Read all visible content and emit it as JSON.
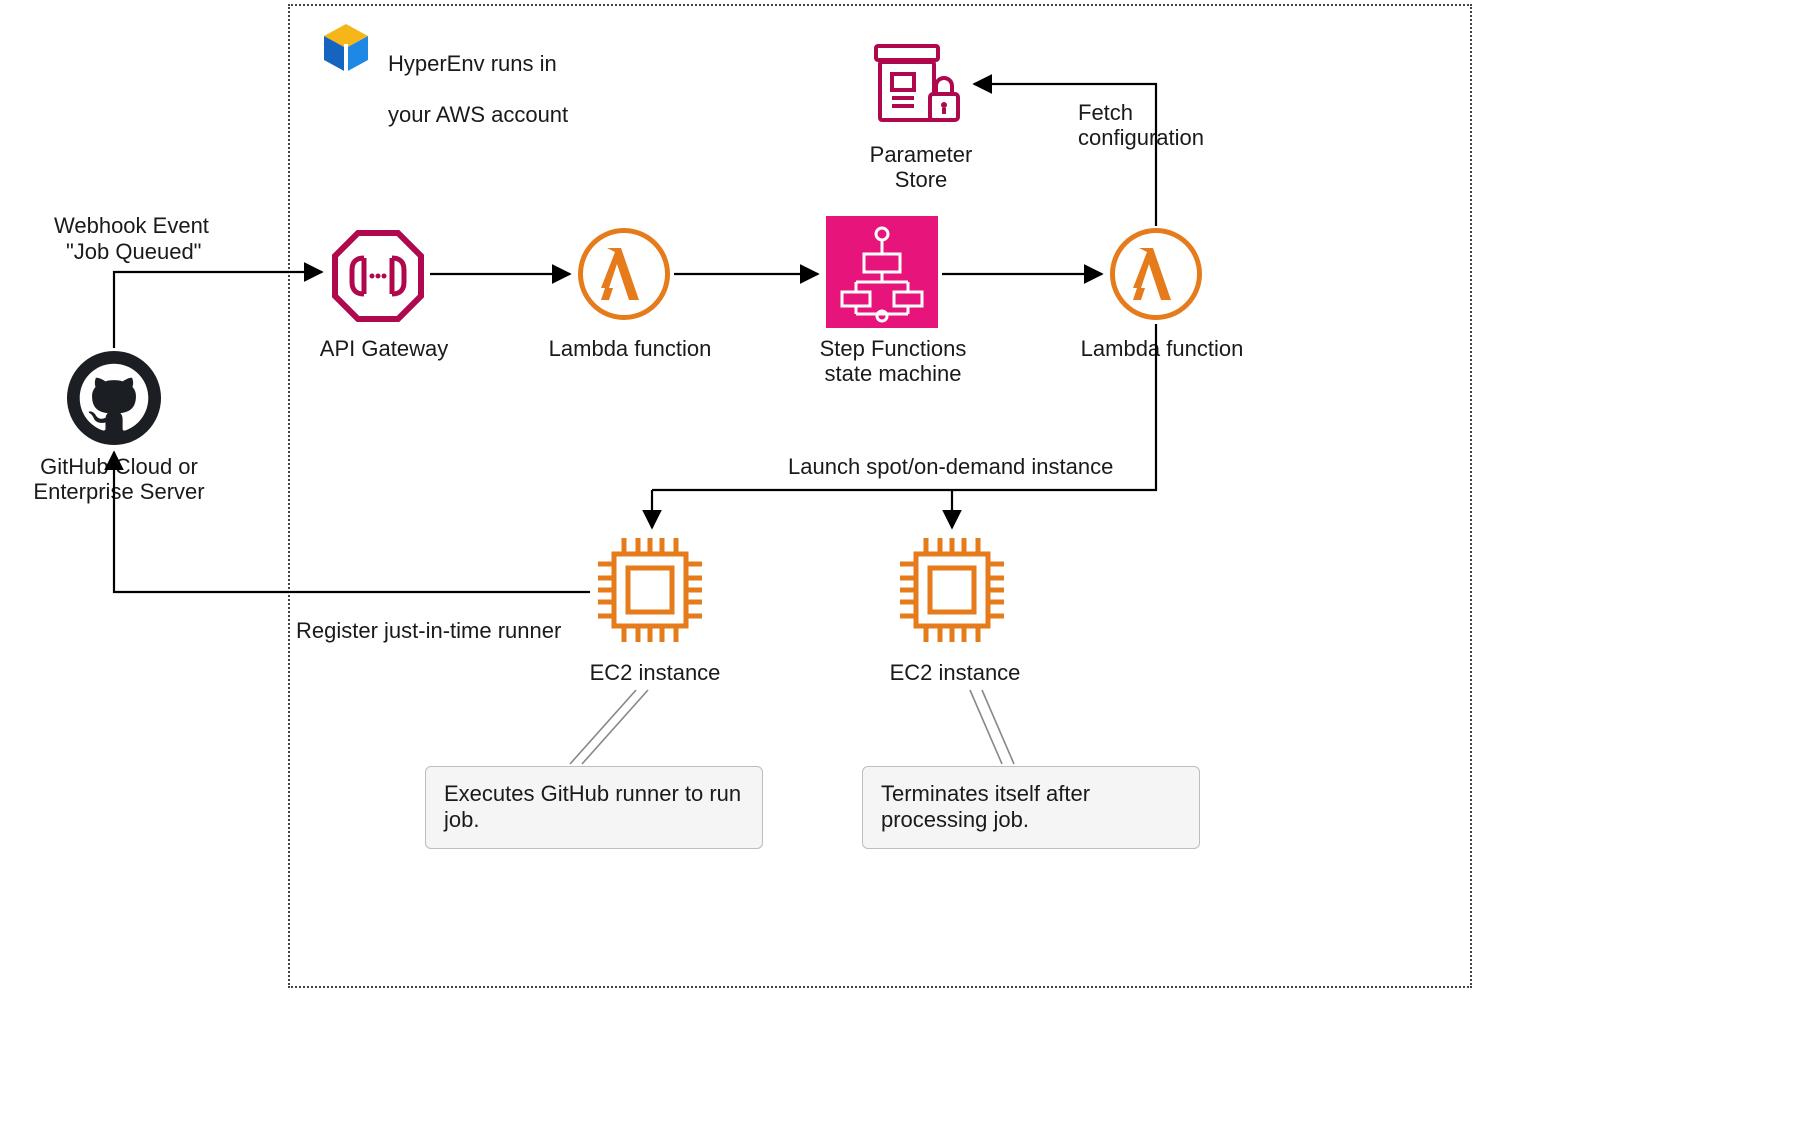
{
  "header": {
    "line1": "HyperEnv runs in",
    "line2": "your AWS account"
  },
  "github": {
    "label": "GitHub Cloud or\nEnterprise Server",
    "webhook_event_line1": "Webhook Event",
    "webhook_event_line2": "\"Job Queued\"",
    "register_label": "Register just-in-time runner"
  },
  "nodes": {
    "api_gateway": "API Gateway",
    "lambda1": "Lambda function",
    "stepfn": "Step Functions\nstate machine",
    "lambda2": "Lambda function",
    "param_store": "Parameter\nStore",
    "ec2_1": "EC2 instance",
    "ec2_2": "EC2 instance"
  },
  "edges": {
    "fetch_config": "Fetch\nconfiguration",
    "launch_instance": "Launch spot/on-demand instance"
  },
  "notes": {
    "ec2_1": "Executes GitHub runner\nto run job.",
    "ec2_2": "Terminates itself after\nprocessing job."
  }
}
